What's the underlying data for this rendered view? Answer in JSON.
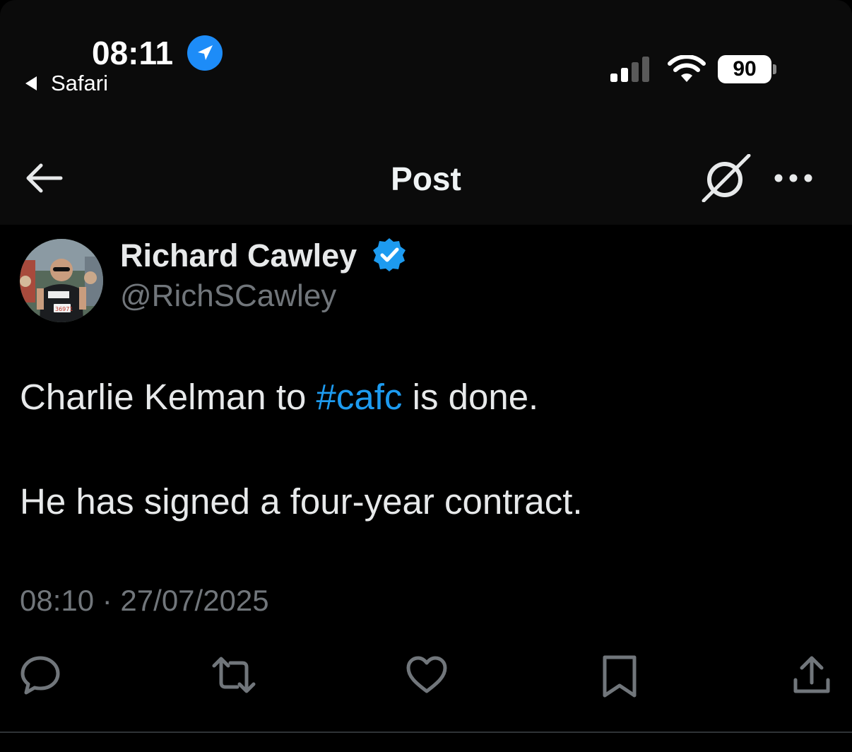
{
  "status_bar": {
    "time": "08:11",
    "back_app": "Safari",
    "battery": "90"
  },
  "nav": {
    "title": "Post"
  },
  "post": {
    "author_name": "Richard Cawley",
    "author_handle": "@RichSCawley",
    "line1_before": "Charlie Kelman to ",
    "hashtag": "#cafc",
    "line1_after": " is done.",
    "line2": "He has signed a four-year contract.",
    "timestamp": "08:10 · 27/07/2025",
    "avatar_bib": "36971"
  },
  "colors": {
    "background": "#000000",
    "header": "#0b0b0b",
    "text_primary": "#e7e9ea",
    "text_secondary": "#71767b",
    "accent": "#1d9bf0"
  },
  "icons": {
    "status": [
      "location-arrow-icon",
      "back-triangle-icon",
      "cellular-signal-icon",
      "wifi-icon",
      "battery-icon"
    ],
    "nav": [
      "back-arrow-icon",
      "grok-icon",
      "more-icon"
    ],
    "actions": [
      "reply-icon",
      "repost-icon",
      "like-icon",
      "bookmark-icon",
      "share-icon"
    ]
  }
}
